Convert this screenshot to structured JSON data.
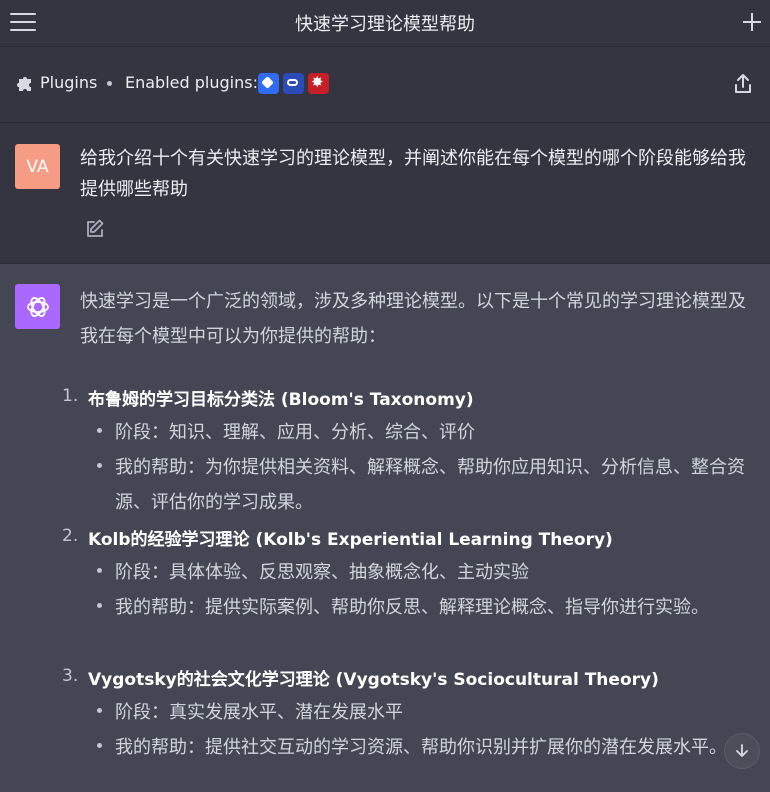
{
  "header": {
    "title": "快速学习理论模型帮助"
  },
  "plugins": {
    "label": "Plugins",
    "enabled_label": "Enabled plugins:",
    "icons": [
      "plugin-diamond-icon",
      "plugin-link-icon",
      "plugin-gear-icon"
    ]
  },
  "user": {
    "avatar": "VA",
    "message": "给我介绍十个有关快速学习的理论模型，并阐述你能在每个模型的哪个阶段能够给我提供哪些帮助"
  },
  "assistant": {
    "intro": "快速学习是一个广泛的领域，涉及多种理论模型。以下是十个常见的学习理论模型及我在每个模型中可以为你提供的帮助：",
    "items": [
      {
        "num": "1.",
        "title": "布鲁姆的学习目标分类法 (Bloom's Taxonomy)",
        "stage": "阶段：知识、理解、应用、分析、综合、评价",
        "help": "我的帮助：为你提供相关资料、解释概念、帮助你应用知识、分析信息、整合资源、评估你的学习成果。"
      },
      {
        "num": "2.",
        "title": "Kolb的经验学习理论 (Kolb's Experiential Learning Theory)",
        "stage": "阶段：具体体验、反思观察、抽象概念化、主动实验",
        "help": "我的帮助：提供实际案例、帮助你反思、解释理论概念、指导你进行实验。"
      },
      {
        "num": "3.",
        "title": "Vygotsky的社会文化学习理论 (Vygotsky's Sociocultural Theory)",
        "stage": "阶段：真实发展水平、潜在发展水平",
        "help": "我的帮助：提供社交互动的学习资源、帮助你识别并扩展你的潜在发展水平。"
      }
    ]
  }
}
